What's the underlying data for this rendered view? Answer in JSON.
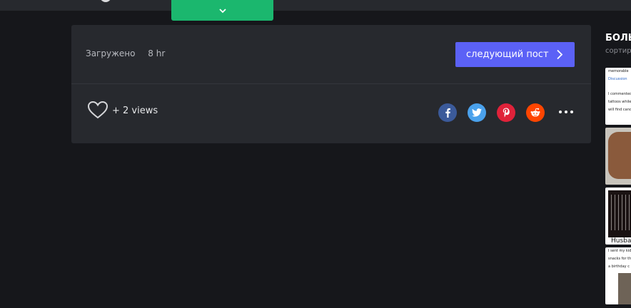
{
  "post": {
    "uploaded_label": "Загружено",
    "uploaded_time": "8 hr",
    "next_post_label": "следующий пост",
    "views_text": "+  2 views"
  },
  "share": {
    "facebook": "f",
    "twitter": "twitter-bird",
    "pinterest": "p",
    "reddit": "reddit-alien"
  },
  "sidebar": {
    "title": "БОЛЬ",
    "subtitle": "сортир",
    "thumbnails": [
      {
        "line1": "memorable",
        "line2": "Discussion",
        "line3": "I commented o",
        "line4": "tattoos while t",
        "line5": "will find cancer"
      },
      {
        "caption": ""
      },
      {
        "caption": "Husba"
      },
      {
        "line1": "I sent my kid",
        "line2": "snacks for th",
        "line3": "a birthday c"
      }
    ]
  },
  "colors": {
    "page_bg": "#16171b",
    "card_bg": "#27292e",
    "accent_button": "#5b61f6",
    "green_tab": "#1bb76e",
    "facebook": "#3b5a9a",
    "twitter": "#4aa1ec",
    "pinterest": "#e0223a",
    "reddit": "#ff4500"
  }
}
